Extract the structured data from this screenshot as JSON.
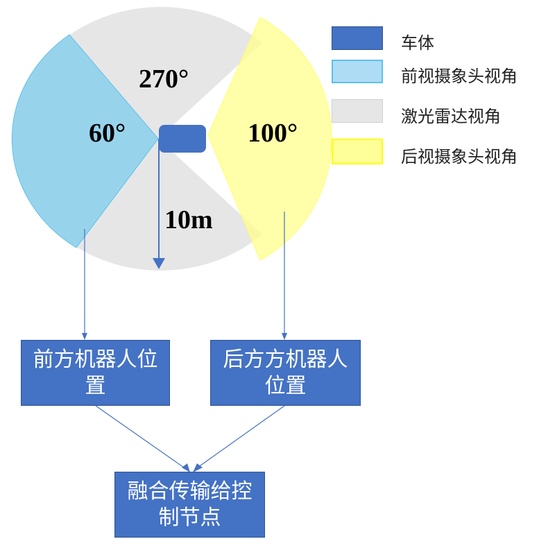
{
  "diagram": {
    "labels": {
      "lidar_angle": "270°",
      "front_angle": "60°",
      "rear_angle": "100°",
      "range": "10m"
    },
    "legend": [
      {
        "label": "车体",
        "color": "#4472c4"
      },
      {
        "label": "前视摄象头视角",
        "color": "#aedcf5"
      },
      {
        "label": "激光雷达视角",
        "color": "#e6e6e6"
      },
      {
        "label": "后视摄象头视角",
        "color": "#ffff99"
      }
    ],
    "nodes": {
      "front": "前方机器人位置",
      "rear": "后方方机器人位置",
      "fusion": "融合传输给控制节点"
    }
  }
}
